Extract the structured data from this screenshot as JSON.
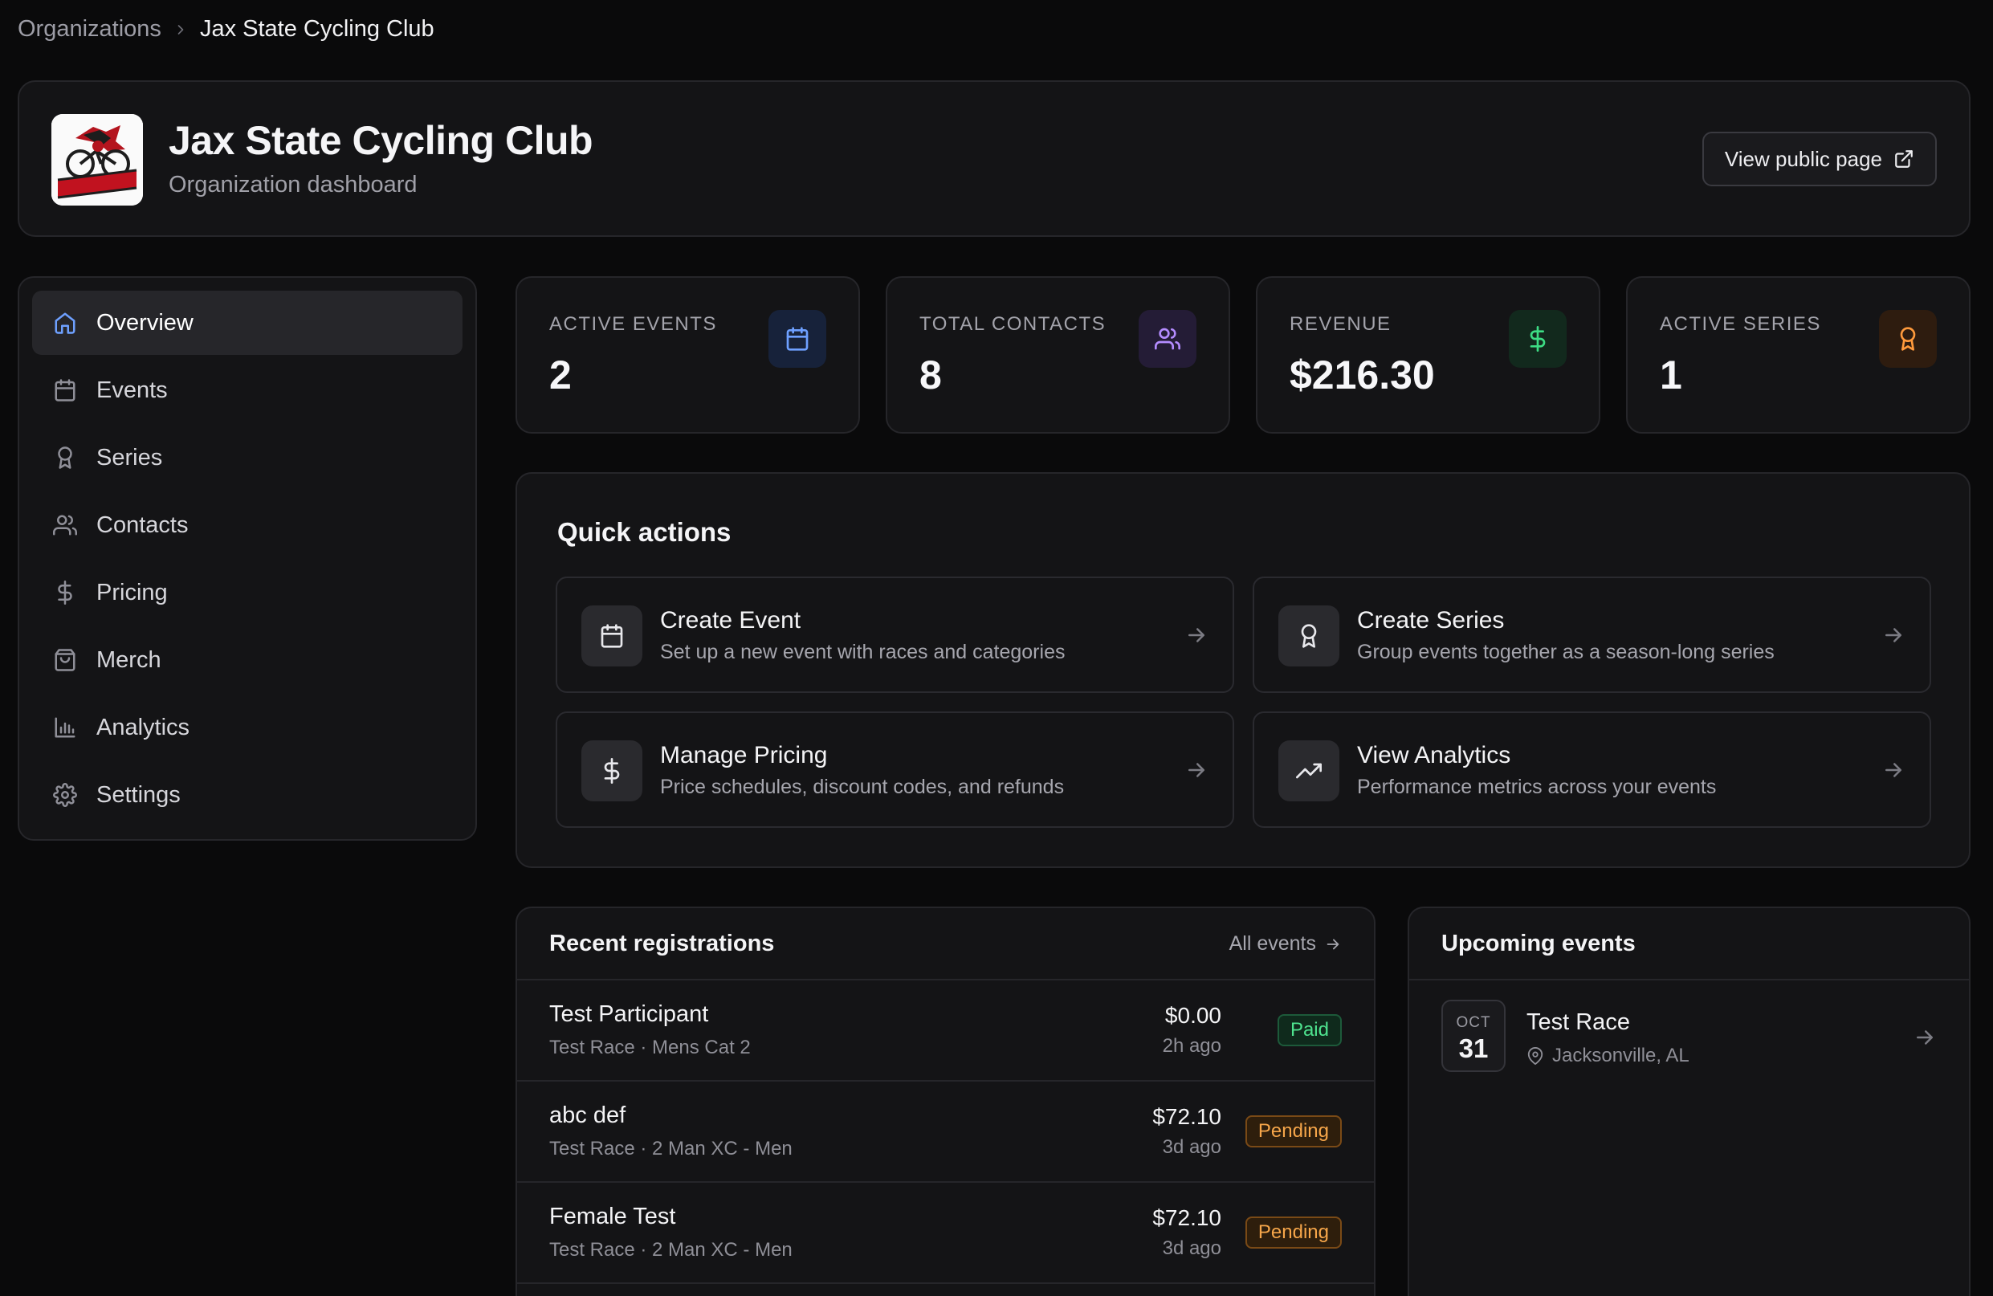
{
  "breadcrumb": {
    "parent": "Organizations",
    "current": "Jax State Cycling Club"
  },
  "header": {
    "title": "Jax State Cycling Club",
    "subtitle": "Organization dashboard",
    "view_public_label": "View public page",
    "logo_icon": "jax-state-cycling-logo",
    "logo_text": "JAX STATE"
  },
  "sidebar": {
    "items": [
      {
        "label": "Overview",
        "icon": "home-icon",
        "active": true
      },
      {
        "label": "Events",
        "icon": "calendar-icon"
      },
      {
        "label": "Series",
        "icon": "award-icon"
      },
      {
        "label": "Contacts",
        "icon": "users-icon"
      },
      {
        "label": "Pricing",
        "icon": "dollar-icon"
      },
      {
        "label": "Merch",
        "icon": "shopping-bag-icon"
      },
      {
        "label": "Analytics",
        "icon": "bar-chart-icon"
      },
      {
        "label": "Settings",
        "icon": "gear-icon"
      }
    ]
  },
  "stats": [
    {
      "label": "ACTIVE EVENTS",
      "value": "2",
      "icon": "calendar-icon",
      "color": "#6ea0ff",
      "bg": "#17223a"
    },
    {
      "label": "TOTAL CONTACTS",
      "value": "8",
      "icon": "users-icon",
      "color": "#b48cff",
      "bg": "#241c36"
    },
    {
      "label": "REVENUE",
      "value": "$216.30",
      "icon": "dollar-icon",
      "color": "#3ddc84",
      "bg": "#12291d"
    },
    {
      "label": "ACTIVE SERIES",
      "value": "1",
      "icon": "award-icon",
      "color": "#ff9a3c",
      "bg": "#2e1c0f"
    }
  ],
  "quick_actions": {
    "title": "Quick actions",
    "items": [
      {
        "title": "Create Event",
        "desc": "Set up a new event with races and categories",
        "icon": "calendar-icon"
      },
      {
        "title": "Create Series",
        "desc": "Group events together as a season-long series",
        "icon": "award-icon"
      },
      {
        "title": "Manage Pricing",
        "desc": "Price schedules, discount codes, and refunds",
        "icon": "dollar-icon"
      },
      {
        "title": "View Analytics",
        "desc": "Performance metrics across your events",
        "icon": "trending-up-icon"
      }
    ]
  },
  "recent": {
    "title": "Recent registrations",
    "all_events_label": "All events",
    "rows": [
      {
        "name": "Test Participant",
        "meta": "Test Race · Mens Cat 2",
        "amount": "$0.00",
        "time": "2h ago",
        "status": "Paid"
      },
      {
        "name": "abc def",
        "meta": "Test Race · 2 Man XC - Men",
        "amount": "$72.10",
        "time": "3d ago",
        "status": "Pending"
      },
      {
        "name": "Female Test",
        "meta": "Test Race · 2 Man XC - Men",
        "amount": "$72.10",
        "time": "3d ago",
        "status": "Pending"
      }
    ]
  },
  "upcoming": {
    "title": "Upcoming events",
    "items": [
      {
        "month": "OCT",
        "day": "31",
        "name": "Test Race",
        "location": "Jacksonville, AL"
      }
    ]
  },
  "colors": {
    "background": "#0a0a0b",
    "card": "#141416",
    "border": "#26262a",
    "accent": "#6ea0ff",
    "paid": "#4ee28e",
    "pending": "#f6a64a"
  }
}
